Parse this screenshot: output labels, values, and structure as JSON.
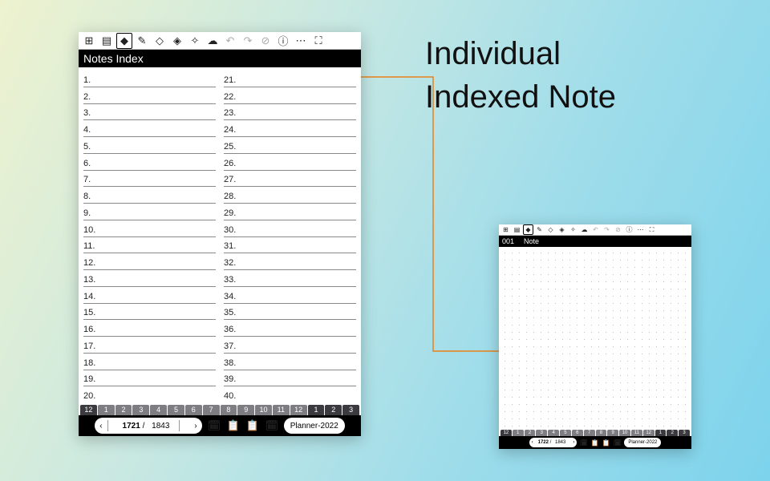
{
  "title_line1": "Individual",
  "title_line2": "Indexed Note",
  "index": {
    "header": "Notes Index",
    "col1": [
      "1.",
      "2.",
      "3.",
      "4.",
      "5.",
      "6.",
      "7.",
      "8.",
      "9.",
      "10.",
      "11.",
      "12.",
      "13.",
      "14.",
      "15.",
      "16.",
      "17.",
      "18.",
      "19.",
      "20."
    ],
    "col2": [
      "21.",
      "22.",
      "23.",
      "24.",
      "25.",
      "26.",
      "27.",
      "28.",
      "29.",
      "30.",
      "31.",
      "32.",
      "33.",
      "34.",
      "35.",
      "36.",
      "37.",
      "38.",
      "39.",
      "40."
    ],
    "tabs": [
      "12",
      "1",
      "2",
      "3",
      "4",
      "5",
      "6",
      "7",
      "8",
      "9",
      "10",
      "11",
      "12",
      "1",
      "2",
      "3"
    ],
    "page_current": "1721",
    "page_total": "1843",
    "doc_name": "Planner-2022"
  },
  "note": {
    "num": "001",
    "label": "Note",
    "tabs": [
      "12",
      "1",
      "2",
      "3",
      "4",
      "5",
      "6",
      "7",
      "8",
      "9",
      "10",
      "11",
      "12",
      "1",
      "2",
      "3"
    ],
    "page_current": "1722",
    "page_total": "1843",
    "doc_name": "Planner-2022"
  },
  "toolbar_icons": [
    "⊞",
    "▤",
    "◆",
    "✎",
    "◇",
    "◈",
    "✧",
    "☁",
    "↶",
    "↷",
    "⊘",
    "ⓘ",
    "⋯",
    "⛶"
  ],
  "footer_icons": [
    "🗓",
    "📋",
    "📋",
    "🗓"
  ]
}
